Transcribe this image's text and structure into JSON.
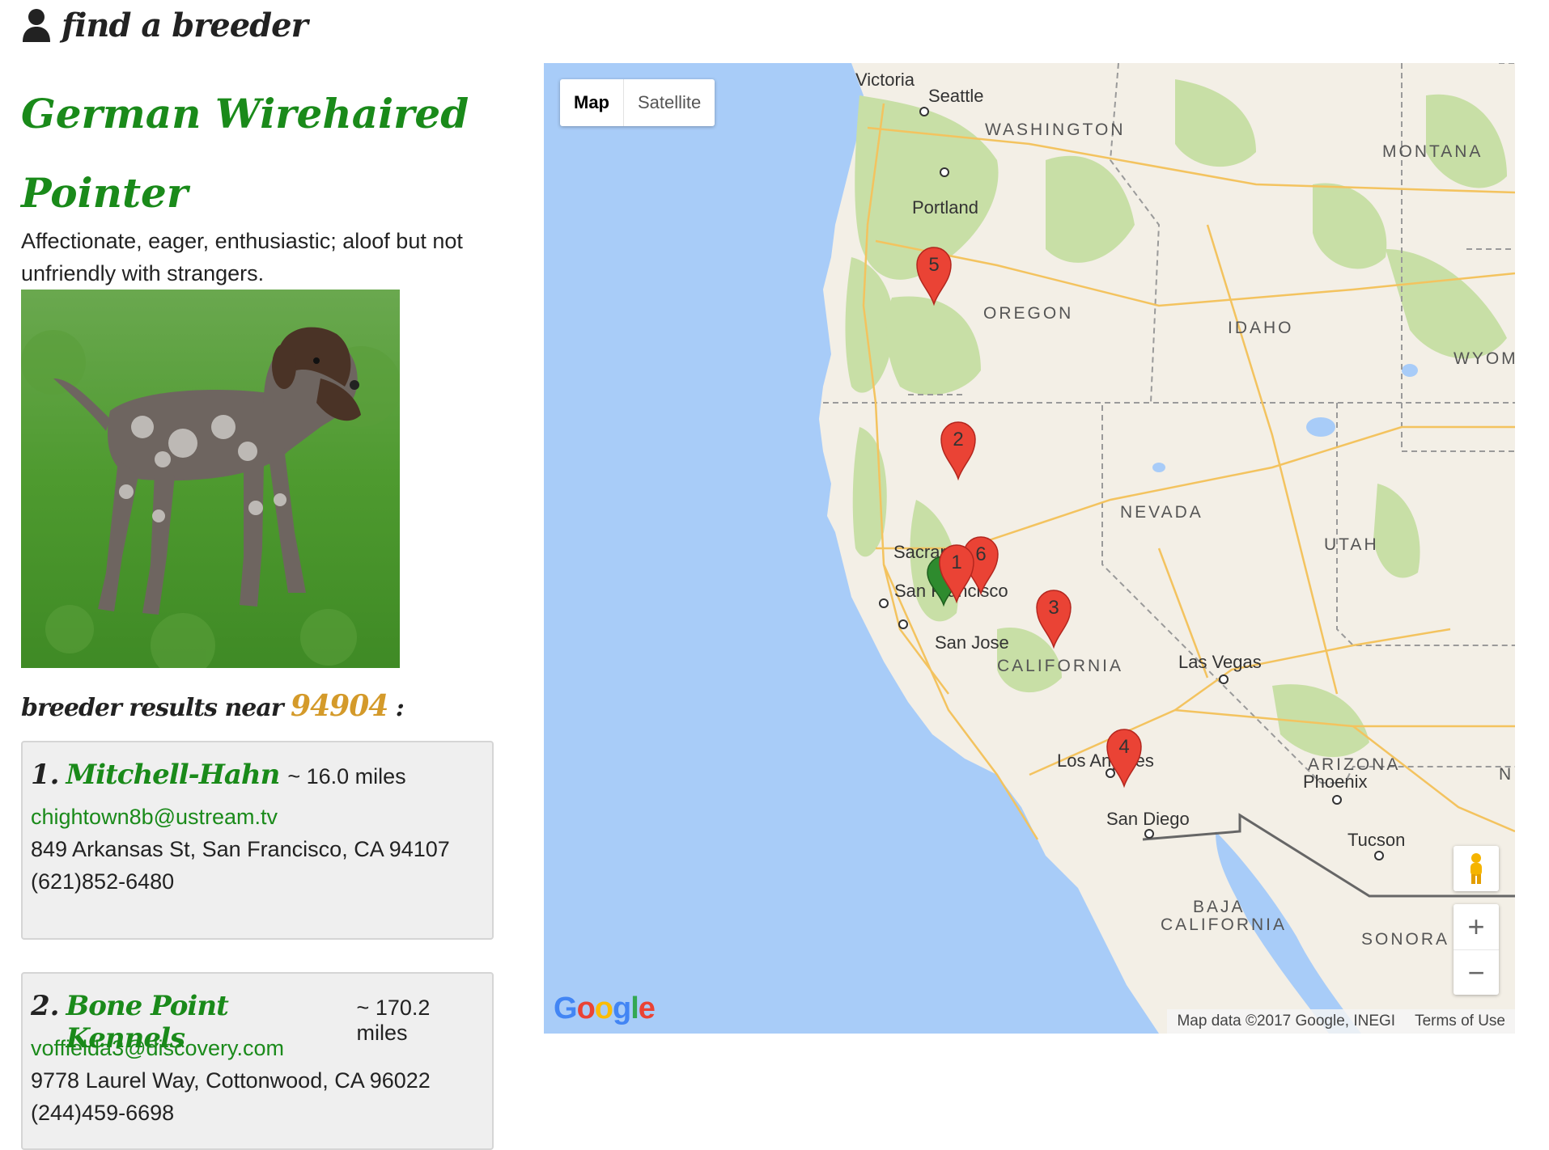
{
  "header": {
    "title": "find a breeder",
    "icon": "person-icon"
  },
  "breed": {
    "name_line1": "German Wirehaired",
    "name_line2": "Pointer",
    "description": "Affectionate, eager, enthusiastic; aloof but not unfriendly with strangers."
  },
  "results": {
    "label": "breeder results near",
    "zip": "94904",
    "suffix": ":"
  },
  "breeders": [
    {
      "num": "1.",
      "name": "Mitchell-Hahn",
      "distance": "~ 16.0 miles",
      "email": "chightown8b@ustream.tv",
      "address": "849 Arkansas St, San Francisco, CA 94107",
      "phone": "(621)852-6480"
    },
    {
      "num": "2.",
      "name": "Bone Point Kennels",
      "distance": "~ 170.2 miles",
      "email": "voffielda3@discovery.com",
      "address": "9778 Laurel Way, Cottonwood, CA 96022",
      "phone": "(244)459-6698"
    }
  ],
  "map": {
    "type_map": "Map",
    "type_satellite": "Satellite",
    "zoom_in": "+",
    "zoom_out": "−",
    "google": "Google",
    "attribution": "Map data ©2017 Google, INEGI",
    "terms": "Terms of Use",
    "cities": {
      "victoria": "Victoria",
      "seattle": "Seattle",
      "portland": "Portland",
      "sacramento": "Sacramento",
      "san_francisco": "San Francisco",
      "san_jose": "San Jose",
      "las_vegas": "Las Vegas",
      "los_angeles": "Los Angeles",
      "san_diego": "San Diego",
      "phoenix": "Phoenix",
      "tucson": "Tucson"
    },
    "states": {
      "washington": "WASHINGTON",
      "montana": "MONTANA",
      "oregon": "OREGON",
      "idaho": "IDAHO",
      "wyoming": "WYOM",
      "nevada": "NEVADA",
      "utah": "UTAH",
      "california": "CALIFORNIA",
      "arizona": "ARIZONA",
      "baja1": "BAJA",
      "baja2": "CALIFORNIA",
      "sonora": "SONORA",
      "nm": "NI"
    },
    "markers": [
      "1",
      "2",
      "3",
      "4",
      "5",
      "6"
    ],
    "marker_color": "#ea4335",
    "home_marker_color": "#2e8b2e",
    "land_color": "#f3efe6",
    "water_color": "#a8ccf8",
    "park_color": "#c8dfa6"
  }
}
